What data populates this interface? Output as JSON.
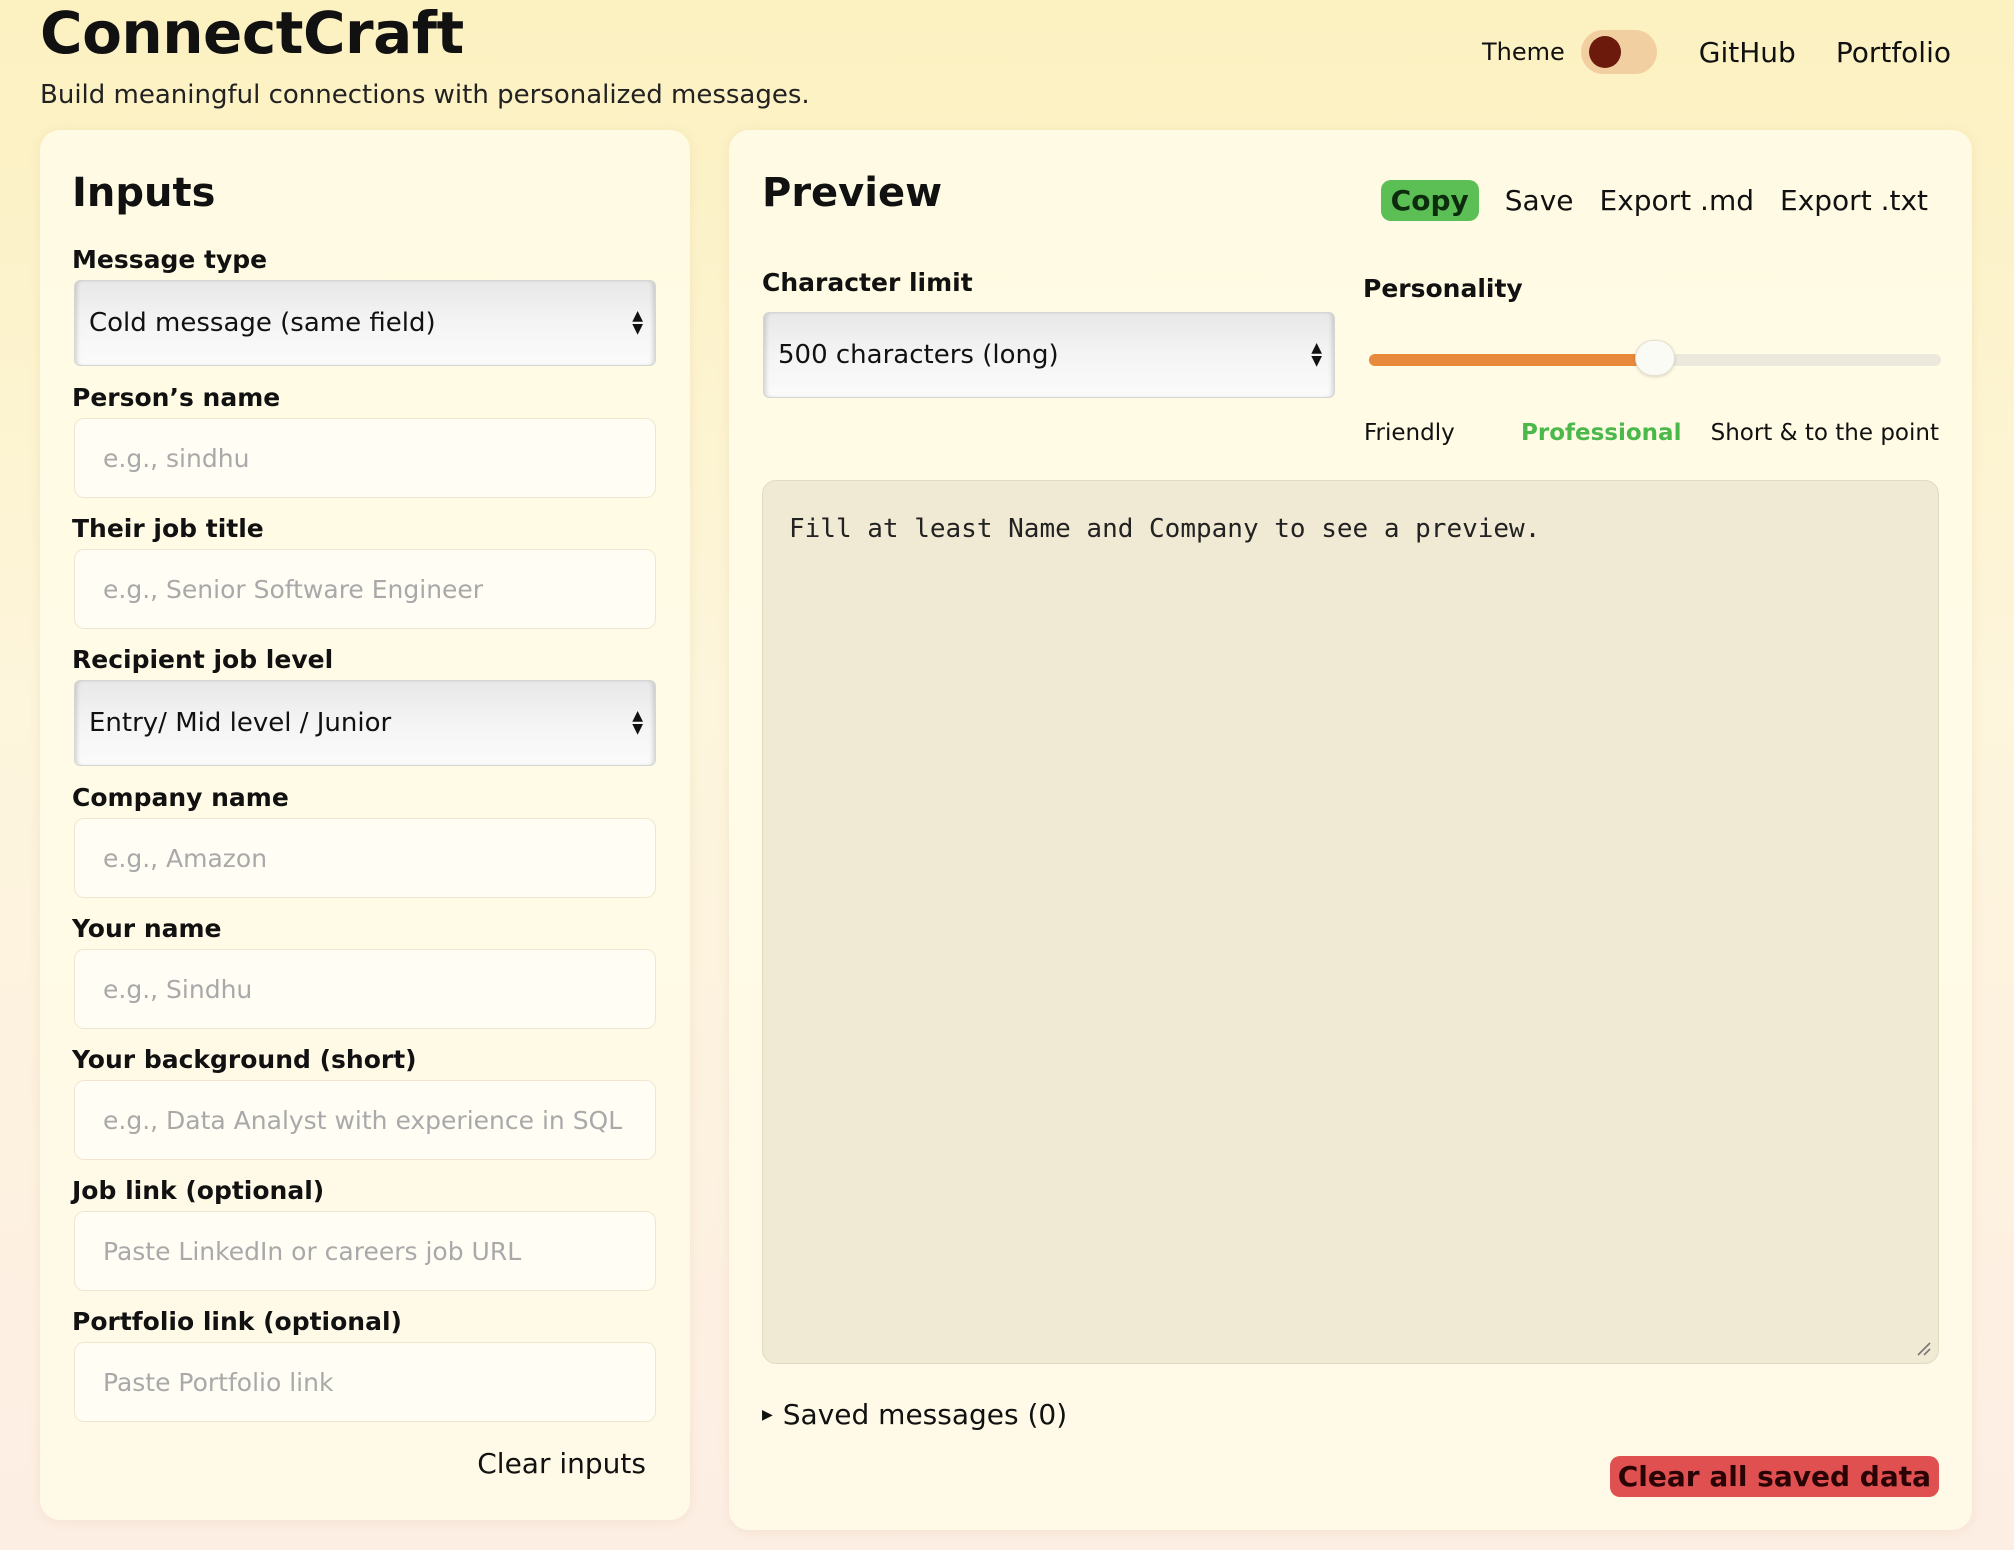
{
  "header": {
    "brand": "ConnectCraft",
    "tagline": "Build meaningful connections with personalized messages.",
    "theme_label": "Theme",
    "nav": [
      "GitHub",
      "Portfolio"
    ]
  },
  "inputs": {
    "title": "Inputs",
    "message_type": {
      "label": "Message type",
      "value": "Cold message (same field)"
    },
    "person_name": {
      "label": "Person’s name",
      "placeholder": "e.g., sindhu"
    },
    "job_title": {
      "label": "Their job title",
      "placeholder": "e.g., Senior Software Engineer"
    },
    "job_level": {
      "label": "Recipient job level",
      "value": "Entry/ Mid level / Junior"
    },
    "company": {
      "label": "Company name",
      "placeholder": "e.g., Amazon"
    },
    "your_name": {
      "label": "Your name",
      "placeholder": "e.g., Sindhu"
    },
    "background": {
      "label": "Your background (short)",
      "placeholder": "e.g., Data Analyst with experience in SQL ar"
    },
    "job_link": {
      "label": "Job link (optional)",
      "placeholder": "Paste LinkedIn or careers job URL"
    },
    "portfolio_link": {
      "label": "Portfolio link (optional)",
      "placeholder": "Paste Portfolio link"
    },
    "clear_label": "Clear inputs"
  },
  "preview": {
    "title": "Preview",
    "actions": {
      "copy": "Copy",
      "save": "Save",
      "export_md": "Export .md",
      "export_txt": "Export .txt"
    },
    "char_limit": {
      "label": "Character limit",
      "value": "500 characters (long)"
    },
    "personality": {
      "label": "Personality",
      "level": 0.5,
      "ticks": [
        "Friendly",
        "Professional",
        "Short & to the point"
      ],
      "selected": "Professional"
    },
    "text": "Fill at least Name and Company to see a preview.",
    "saved_label": "Saved messages (0)",
    "clear_all_label": "Clear all saved data"
  },
  "colors": {
    "accent_orange": "#e88a3c",
    "copy_green": "#5cbf55",
    "selected_green": "#4bb84b",
    "danger_red": "#e05050"
  }
}
